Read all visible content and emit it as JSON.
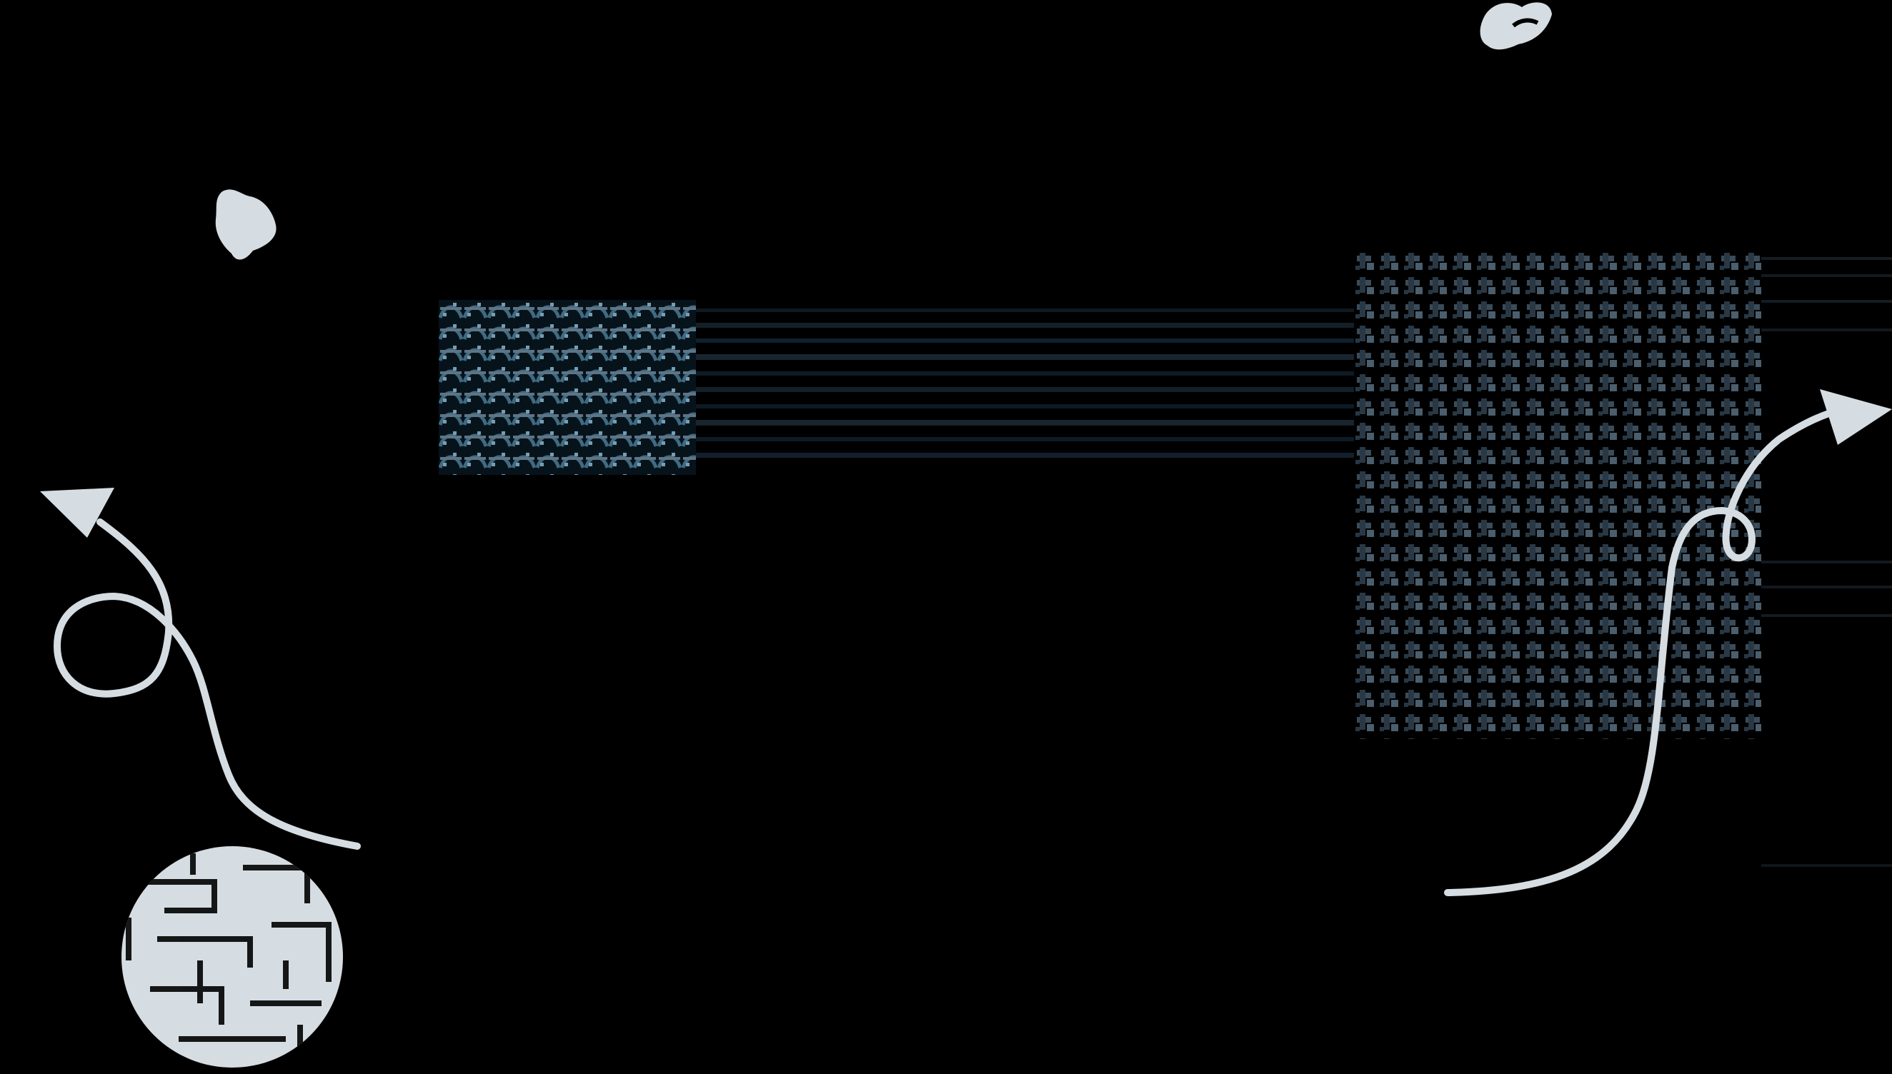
{
  "palette": {
    "background": "#000000",
    "light": "#d6dde2",
    "pattern_blue": "#3f6a82",
    "pattern_gray": "#5f7485",
    "line_dark": "#1c2a36"
  },
  "decor": {
    "cursor_blob_icon": "cursor-blob-icon",
    "left_arrow_icon": "arrow-loop-left-icon",
    "right_arrow_icon": "arrow-curve-right-icon",
    "scribble_ball_icon": "scribble-ball-icon",
    "leaf_icon": "leaf-icon"
  }
}
